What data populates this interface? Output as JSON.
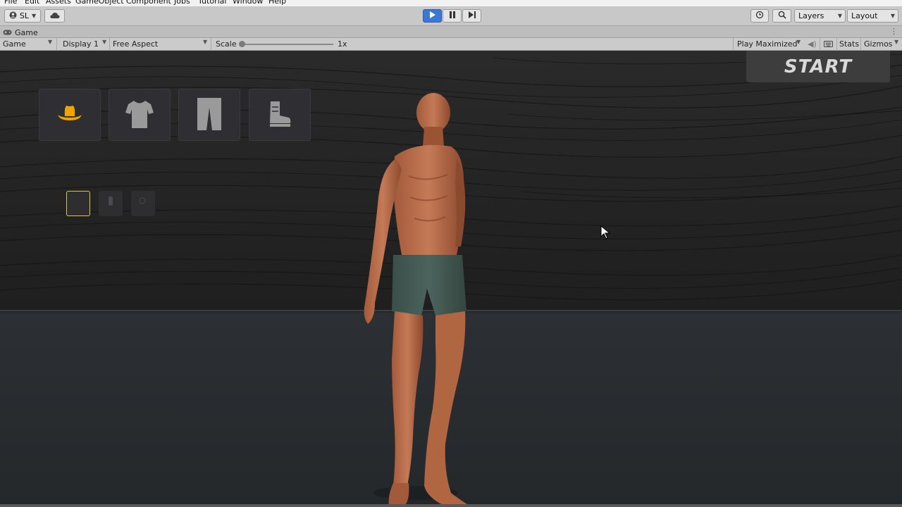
{
  "menu": [
    "File",
    "Edit",
    "Assets",
    "GameObject",
    "Component",
    "Jobs",
    "Tutorial",
    "Window",
    "Help"
  ],
  "toolbar": {
    "account_label": "SL",
    "layers_label": "Layers",
    "layout_label": "Layout"
  },
  "tab": {
    "label": "Game"
  },
  "gamebar": {
    "mode": "Game",
    "display": "Display 1",
    "aspect": "Free Aspect",
    "scale_label": "Scale",
    "scale_value": "1x",
    "play_mode": "Play Maximized",
    "stats": "Stats",
    "gizmos": "Gizmos"
  },
  "game": {
    "start_label": "START",
    "categories": [
      "hat-icon",
      "shirt-icon",
      "pants-icon",
      "boot-icon"
    ],
    "accent": "#f0a400"
  }
}
